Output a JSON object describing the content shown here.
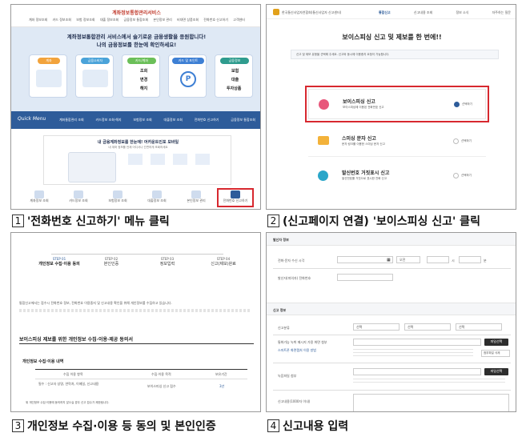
{
  "captions": {
    "c1_num": "1",
    "c1_text": "'전화번호 신고하기' 메뉴 클릭",
    "c2_num": "2",
    "c2_text": "(신고페이지 연결) '보이스피싱 신고' 클릭",
    "c3_num": "3",
    "c3_text": "개인정보 수집·이용 등 동의 및 본인인증",
    "c4_num": "4",
    "c4_text": "신고내용 입력"
  },
  "p1": {
    "site_title": "계좌정보통합관리서비스",
    "nav": [
      "계좌 정보조회",
      "카드 정보조회",
      "보험 정보조회",
      "대출 정보조회",
      "금융정보 통합조회",
      "본인정보 관리",
      "비대면 상품조회",
      "전화번호 신고하기",
      "고객센터"
    ],
    "hero_line1": "계좌정보통합관리 서비스에서 슬기로운 금융생활을 응원합니다!",
    "hero_line2": "나의 금융정보를 한눈에 확인하세요!",
    "cards": [
      {
        "title": "계좌",
        "color": "#f2a33c"
      },
      {
        "title": "금융소비자",
        "color": "#4aa3d9"
      },
      {
        "title": "카드/계좌",
        "color": "#6bbf59"
      },
      {
        "title": "카드 및 포인트",
        "color": "#3d7fd4"
      },
      {
        "title": "금융정보",
        "color": "#2f9c8e"
      }
    ],
    "card_items": [
      "조회",
      "변경",
      "해지",
      "보험",
      "대출",
      "투자상품"
    ],
    "quick_menu": "Quick Menu",
    "quick_items": [
      "계좌통합관리 조회",
      "카드정보 조회·해지",
      "보험정보 조회",
      "대출정보 조회",
      "전화번호 신고하기",
      "금융정보 통합조회"
    ],
    "mid_title": "내 금융계좌정보를 한눈에! 어카운트인포 모바일",
    "mid_sub": "내 계좌 정보를 언제 어디서나 간편하게 조회하세요",
    "bottom_items": [
      "계좌정보 조회",
      "카드정보 조회",
      "보험정보 조회",
      "대출정보 조회",
      "본인정보 관리",
      "전화번호 신고하기"
    ]
  },
  "p2": {
    "org": "한국통신사업자연합회(통신사업자 신고센터)",
    "nav": [
      "통합신고",
      "신고내용 조회",
      "정보 소식",
      "자주하는 질문"
    ],
    "title": "보이스피싱 신고 및 제보를 한 번에!!",
    "notice": "신고 및 제보 유형을 선택해 주세요. 신고와 동시에 이용중지 요청이 가능합니다.",
    "options": [
      {
        "title": "보이스피싱 신고",
        "desc": "보이스피싱에 이용된 전화번호 신고",
        "choose": "선택하기",
        "color": "#e8577b"
      },
      {
        "title": "스미싱 문자 신고",
        "desc": "문자 링크를 이용한 스미싱 문자 신고",
        "choose": "선택하기",
        "color": "#f3b23a"
      },
      {
        "title": "발신번호 거짓표시 신고",
        "desc": "발신번호를 거짓으로 표시한 전화 신고",
        "choose": "선택하기",
        "color": "#2aa6c9"
      }
    ]
  },
  "p3": {
    "steps": [
      {
        "no": "STEP 01",
        "label": "개인정보 수집·이용 동의"
      },
      {
        "no": "STEP 02",
        "label": "본인인증"
      },
      {
        "no": "STEP 03",
        "label": "정보입력"
      },
      {
        "no": "STEP 04",
        "label": "신고(제보)완료"
      }
    ],
    "intro": "통합신고에서는 접수시 전화번호 정보, 전화번호 이용중지 및 신고내용 확인을 위해 개인정보를 수집하고 있습니다.",
    "section_title": "보이스피싱 제보를 위한 개인정보 수집·이용·제공 동의서",
    "sub_title": "개인정보 수집·이용 내역",
    "table_headers": [
      "수집 이용 항목",
      "수집·이용 목적",
      "보유기간"
    ],
    "table_row": [
      "필수 : 신고자 성명, 연락처, 이메일, 신고내용",
      "보이스피싱 신고 접수",
      "3년"
    ],
    "footnote": "위 개인정보 수집·이용에 동의하지 않으실 경우 신고 접수가 제한됩니다."
  },
  "p4": {
    "sec1": "발신자 정보",
    "row1_label": "전화·문자 수신 시각",
    "row1_sel": "오전",
    "row1_h": "시",
    "row1_m": "분",
    "row2_label": "발신자(피의자) 전화번호",
    "sec2": "신고 정보",
    "row3_label": "신고분류",
    "row3_sel": [
      "선택",
      "선택",
      "선택"
    ],
    "row4_label": "통화가능 녹취 메시지 가용 화면 첨부",
    "row4_link": "스마트폰 화면캡처 이용 방법",
    "row4_btn": "파일선택",
    "row4_btn2": "첨부파일 삭제",
    "row5_label": "녹음파일 첨부",
    "row5_btn": "파일선택",
    "row6_label": "신고내용(1000자 이내)"
  }
}
